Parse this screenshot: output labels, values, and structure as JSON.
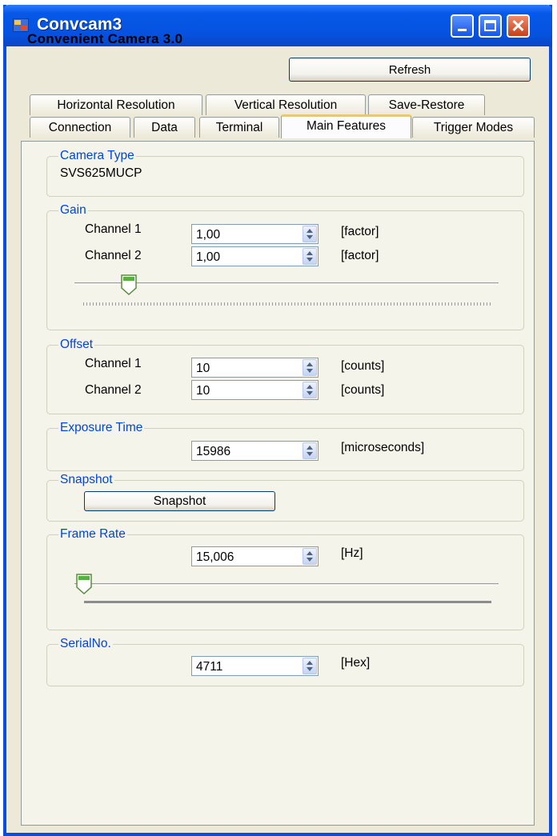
{
  "window": {
    "title": "Convcam3"
  },
  "header": {
    "app_name": "Convenient Camera 3.0",
    "refresh_label": "Refresh"
  },
  "tabs": {
    "row1": [
      "Horizontal Resolution",
      "Vertical Resolution",
      "Save-Restore"
    ],
    "row2": [
      "Connection",
      "Data",
      "Terminal",
      "Main Features",
      "Trigger Modes"
    ],
    "active": "Main Features"
  },
  "camera_type": {
    "legend": "Camera Type",
    "value": "SVS625MUCP"
  },
  "gain": {
    "legend": "Gain",
    "ch1_label": "Channel 1",
    "ch1_value": "1,00",
    "ch1_unit": "[factor]",
    "ch2_label": "Channel 2",
    "ch2_value": "1,00",
    "ch2_unit": "[factor]",
    "slider_fraction": 0.11
  },
  "offset": {
    "legend": "Offset",
    "ch1_label": "Channel 1",
    "ch1_value": "10",
    "ch1_unit": "[counts]",
    "ch2_label": "Channel 2",
    "ch2_value": "10",
    "ch2_unit": "[counts]"
  },
  "exposure": {
    "legend": "Exposure Time",
    "value": "15986",
    "unit": "[microseconds]"
  },
  "snapshot": {
    "legend": "Snapshot",
    "button_label": "Snapshot"
  },
  "frame_rate": {
    "legend": "Frame Rate",
    "value": "15,006",
    "unit": "[Hz]",
    "slider_fraction": 0.0
  },
  "serial": {
    "legend": "SerialNo.",
    "value": "4711",
    "unit": "[Hex]"
  }
}
